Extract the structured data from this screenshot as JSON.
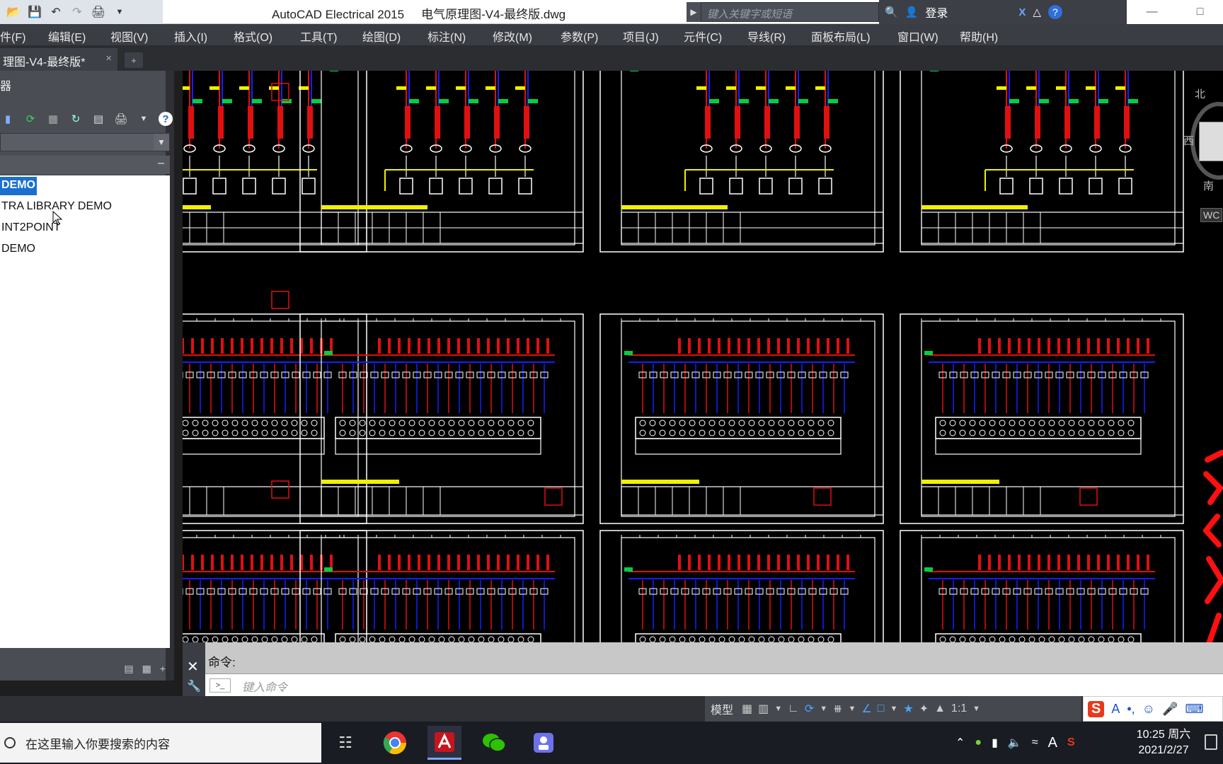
{
  "title_bar": {
    "app_name": "AutoCAD Electrical 2015",
    "file_name": "电气原理图-V4-最终版.dwg",
    "search_placeholder": "键入关键字或短语",
    "login_label": "登录"
  },
  "menu": {
    "items": [
      "件(F)",
      "编辑(E)",
      "视图(V)",
      "插入(I)",
      "格式(O)",
      "工具(T)",
      "绘图(D)",
      "标注(N)",
      "修改(M)",
      "参数(P)",
      "项目(J)",
      "元件(C)",
      "导线(R)",
      "面板布局(L)",
      "窗口(W)",
      "帮助(H)"
    ]
  },
  "doc_tab": {
    "label": "理图-V4-最终版*",
    "close": "×",
    "new_tab": "+"
  },
  "palette": {
    "title": "器",
    "items": [
      "DEMO",
      "TRA LIBRARY DEMO",
      "INT2POINT",
      "DEMO"
    ],
    "selected_index": 0
  },
  "command": {
    "history_label": "命令:",
    "input_placeholder": "键入命令"
  },
  "status": {
    "model_label": "模型",
    "scale_label": "1:1"
  },
  "taskbar": {
    "search_placeholder": "在这里输入你要搜索的内容",
    "time": "10:25 周六",
    "date": "2021/2/27"
  },
  "viewcube": {
    "north": "北",
    "west": "西",
    "south": "南",
    "wcs": "WC"
  },
  "colors": {
    "canvas_bg": "#000000",
    "wire_red": "#e01010",
    "wire_blue": "#1420ff",
    "bus_yellow": "#f0f000",
    "term_green": "#00d040",
    "frame_white": "#ffffff",
    "selected_blue": "#1b6fd1"
  }
}
